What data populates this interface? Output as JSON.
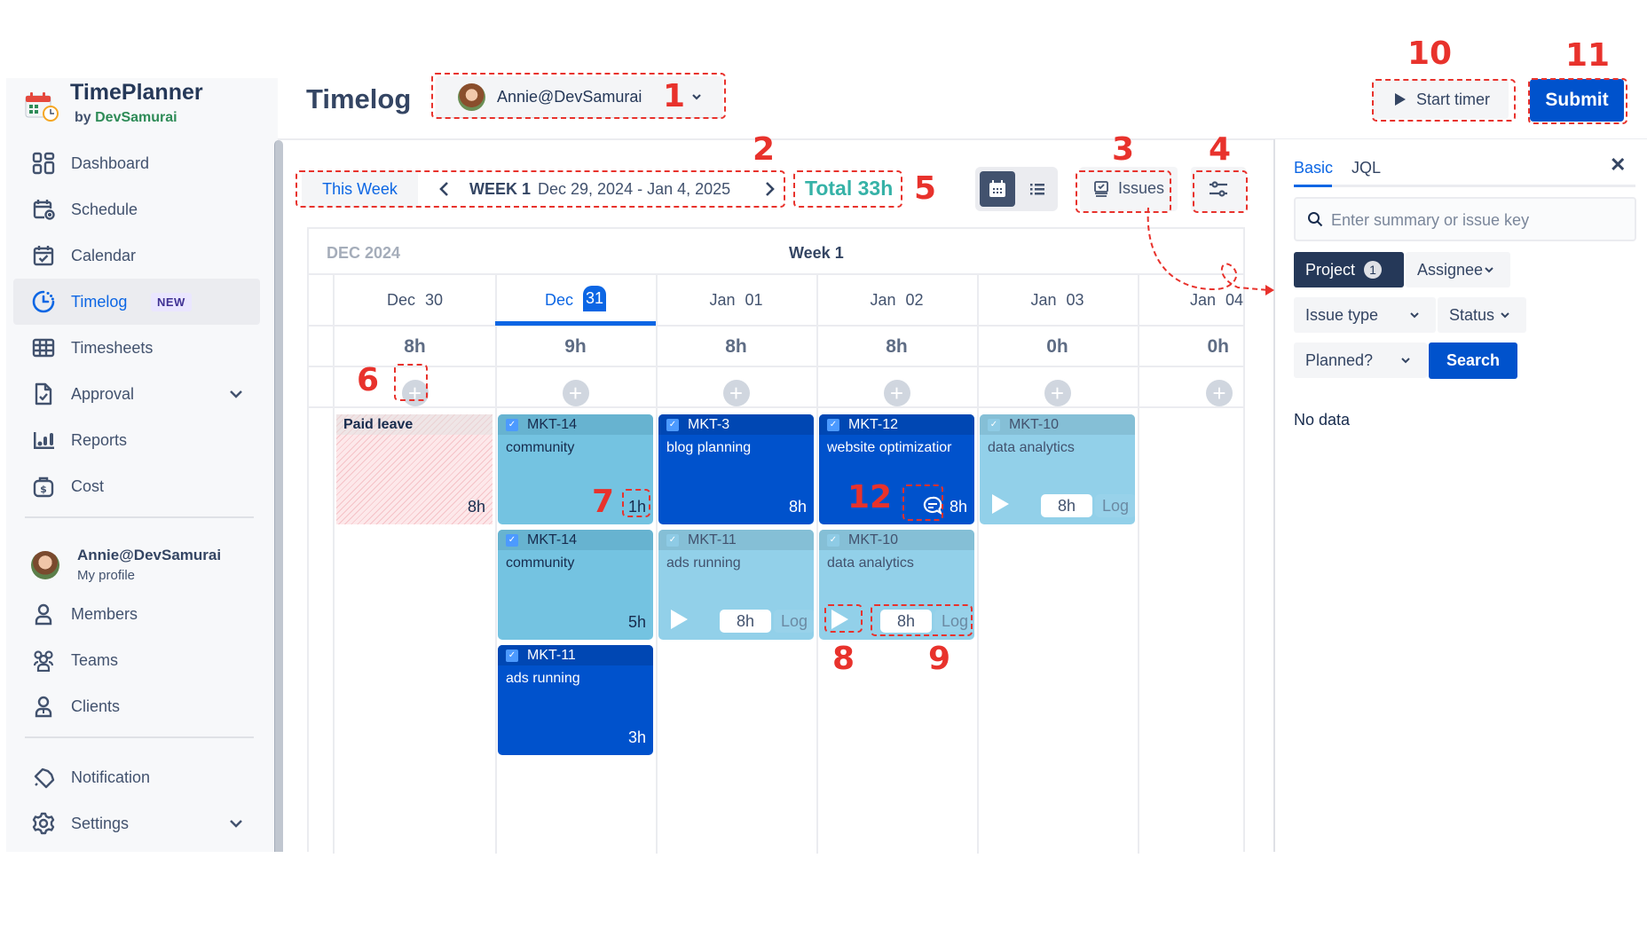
{
  "app": {
    "name": "TimePlanner",
    "by_prefix": "by",
    "by_brand": "DevSamurai"
  },
  "sidebar": {
    "items": [
      {
        "label": "Dashboard",
        "icon": "dashboard-icon"
      },
      {
        "label": "Schedule",
        "icon": "schedule-icon"
      },
      {
        "label": "Calendar",
        "icon": "calendar-icon"
      },
      {
        "label": "Timelog",
        "icon": "timelog-icon",
        "badge": "NEW",
        "active": true
      },
      {
        "label": "Timesheets",
        "icon": "timesheets-icon"
      },
      {
        "label": "Approval",
        "icon": "approval-icon",
        "expandable": true
      },
      {
        "label": "Reports",
        "icon": "reports-icon"
      },
      {
        "label": "Cost",
        "icon": "cost-icon"
      }
    ],
    "profile": {
      "name": "Annie@DevSamurai",
      "sub": "My profile"
    },
    "team_items": [
      {
        "label": "Members",
        "icon": "members-icon"
      },
      {
        "label": "Teams",
        "icon": "teams-icon"
      },
      {
        "label": "Clients",
        "icon": "clients-icon"
      }
    ],
    "bottom_items": [
      {
        "label": "Notification",
        "icon": "notification-icon"
      },
      {
        "label": "Settings",
        "icon": "settings-icon",
        "expandable": true
      }
    ]
  },
  "header": {
    "title": "Timelog",
    "user_select": "Annie@DevSamurai",
    "start_timer": "Start timer",
    "submit": "Submit"
  },
  "toolbar": {
    "this_week": "This Week",
    "week_label": "WEEK 1",
    "week_range": "Dec 29, 2024 - Jan 4, 2025",
    "total": "Total 33h",
    "issues": "Issues"
  },
  "calendar": {
    "month": "DEC 2024",
    "week": "Week 1",
    "days": [
      {
        "mon": "Dec",
        "day": "30",
        "hours": "8h"
      },
      {
        "mon": "Dec",
        "day": "31",
        "hours": "9h",
        "today": true
      },
      {
        "mon": "Jan",
        "day": "01",
        "hours": "8h"
      },
      {
        "mon": "Jan",
        "day": "02",
        "hours": "8h"
      },
      {
        "mon": "Jan",
        "day": "03",
        "hours": "0h"
      },
      {
        "mon": "Jan",
        "day": "04",
        "hours": "0h"
      }
    ],
    "leave": {
      "label": "Paid leave",
      "hours": "8h"
    },
    "cards": [
      {
        "key": "MKT-14",
        "summary": "community",
        "hours": "1h",
        "style": "light",
        "day": 1
      },
      {
        "key": "MKT-14",
        "summary": "community",
        "hours": "5h",
        "style": "light",
        "day": 1
      },
      {
        "key": "MKT-11",
        "summary": "ads running",
        "hours": "3h",
        "style": "dark",
        "day": 1
      },
      {
        "key": "MKT-3",
        "summary": "blog planning",
        "hours": "8h",
        "style": "dark",
        "day": 2
      },
      {
        "key": "MKT-11",
        "summary": "ads running",
        "log_value": "8h",
        "log_label": "Log",
        "style": "pale",
        "day": 2
      },
      {
        "key": "MKT-12",
        "summary": "website optimizatior",
        "hours": "8h",
        "style": "dark",
        "day": 3,
        "has_comment": true
      },
      {
        "key": "MKT-10",
        "summary": "data analytics",
        "log_value": "8h",
        "log_label": "Log",
        "style": "pale",
        "day": 3
      },
      {
        "key": "MKT-10",
        "summary": "data analytics",
        "log_value": "8h",
        "log_label": "Log",
        "style": "pale",
        "day": 4
      }
    ]
  },
  "panel": {
    "tabs": [
      "Basic",
      "JQL"
    ],
    "active_tab": "Basic",
    "search_placeholder": "Enter summary or issue key",
    "filters": {
      "project": "Project",
      "project_count": "1",
      "assignee": "Assignee",
      "issue_type": "Issue type",
      "status": "Status",
      "planned": "Planned?"
    },
    "search_button": "Search",
    "empty": "No data"
  },
  "annotations": [
    "1",
    "2",
    "3",
    "4",
    "5",
    "6",
    "7",
    "8",
    "9",
    "10",
    "11",
    "12"
  ],
  "colors": {
    "primary": "#0052cc",
    "accent": "#0c66e4",
    "total": "#36b2a7",
    "annotation": "#e8322c",
    "card_light": "#74c3e1",
    "card_pale": "#92d0e9",
    "card_dark": "#0052cc"
  }
}
